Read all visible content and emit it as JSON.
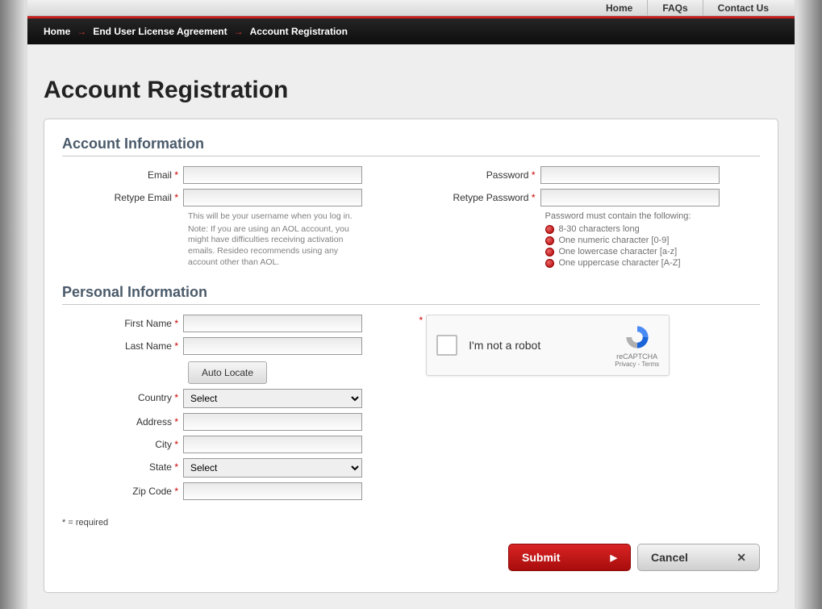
{
  "top_nav": {
    "home": "Home",
    "faqs": "FAQs",
    "contact": "Contact Us"
  },
  "breadcrumb": {
    "home": "Home",
    "eula": "End User License Agreement",
    "current": "Account Registration"
  },
  "page_title": "Account Registration",
  "sections": {
    "account": "Account Information",
    "personal": "Personal Information"
  },
  "labels": {
    "email": "Email",
    "retype_email": "Retype Email",
    "password": "Password",
    "retype_password": "Retype Password",
    "first_name": "First Name",
    "last_name": "Last Name",
    "country": "Country",
    "address": "Address",
    "city": "City",
    "state": "State",
    "zip": "Zip Code"
  },
  "values": {
    "email": "",
    "retype_email": "",
    "password": "",
    "retype_password": "",
    "first_name": "",
    "last_name": "",
    "country_selected": "Select",
    "address": "",
    "city": "",
    "state_selected": "Select",
    "zip": ""
  },
  "hints": {
    "email_username": "This will be your username when you log in.",
    "aol_note": "Note: If you are using an AOL account, you might have difficulties receiving activation emails. Resideo recommends using any account other than AOL.",
    "password_rules_title": "Password must contain the following:"
  },
  "password_rules": [
    "8-30 characters long",
    "One numeric character [0-9]",
    "One lowercase character [a-z]",
    "One uppercase character [A-Z]"
  ],
  "buttons": {
    "auto_locate": "Auto Locate",
    "submit": "Submit",
    "cancel": "Cancel"
  },
  "captcha": {
    "text": "I'm not a robot",
    "brand": "reCAPTCHA",
    "links": "Privacy - Terms"
  },
  "required_note": "* = required"
}
